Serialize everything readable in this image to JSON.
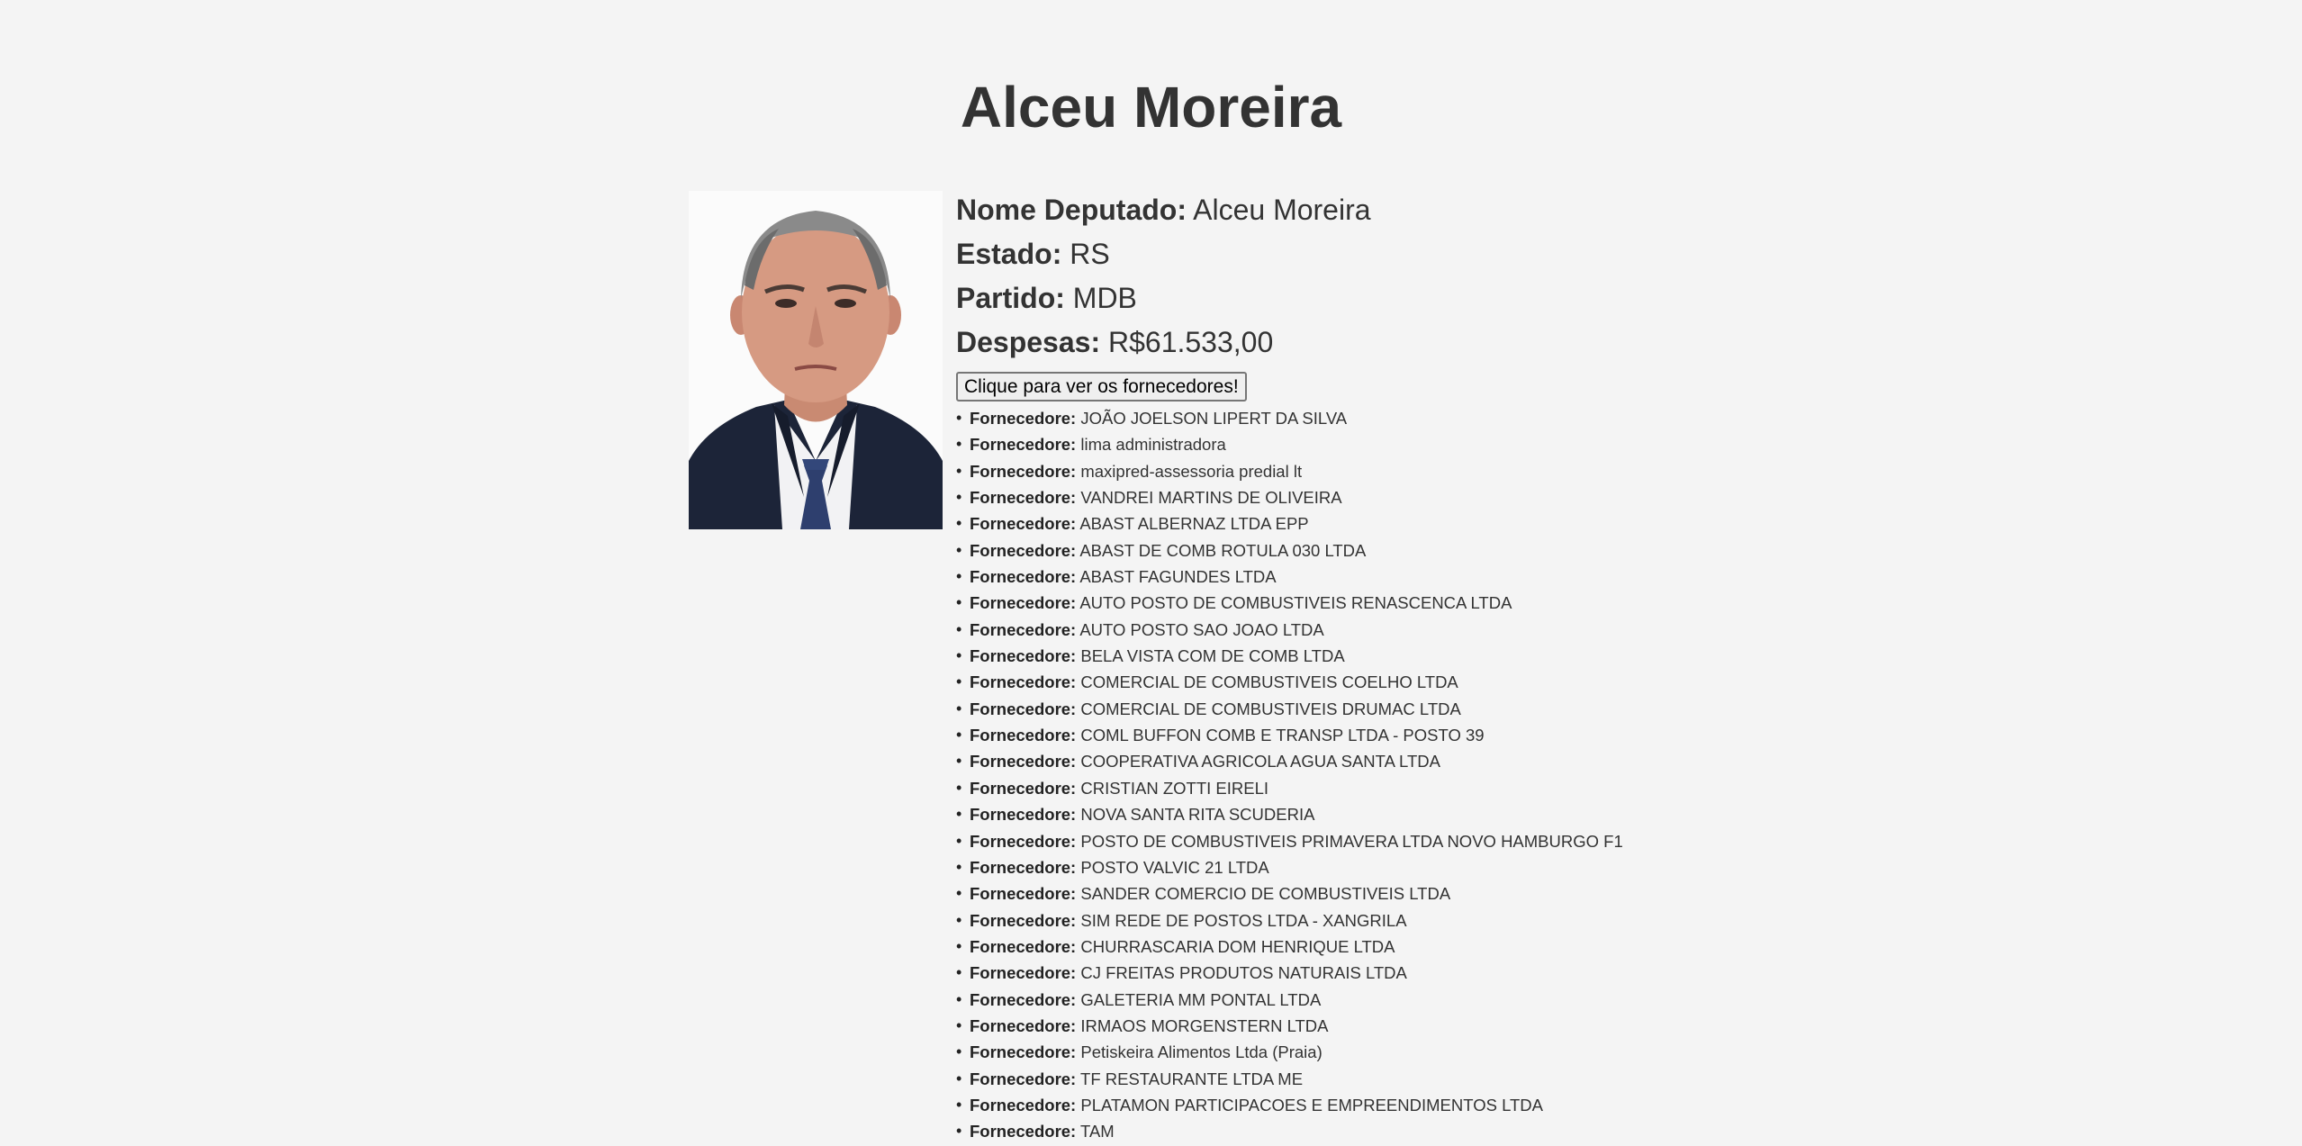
{
  "page": {
    "title": "Alceu Moreira"
  },
  "details": {
    "name_label": "Nome Deputado:",
    "name_value": "Alceu Moreira",
    "state_label": "Estado:",
    "state_value": "RS",
    "party_label": "Partido:",
    "party_value": "MDB",
    "expenses_label": "Despesas:",
    "expenses_value": "R$61.533,00"
  },
  "button": {
    "label": "Clique para ver os fornecedores!"
  },
  "suppliers": {
    "label": "Fornecedore:",
    "items": [
      "JOÃO JOELSON LIPERT DA SILVA",
      "lima administradora",
      "maxipred-assessoria predial lt",
      "VANDREI MARTINS DE OLIVEIRA",
      "ABAST ALBERNAZ LTDA EPP",
      "ABAST DE COMB ROTULA 030 LTDA",
      "ABAST FAGUNDES LTDA",
      "AUTO POSTO DE COMBUSTIVEIS RENASCENCA LTDA",
      "AUTO POSTO SAO JOAO LTDA",
      "BELA VISTA COM DE COMB LTDA",
      "COMERCIAL DE COMBUSTIVEIS COELHO LTDA",
      "COMERCIAL DE COMBUSTIVEIS DRUMAC LTDA",
      "COML BUFFON COMB E TRANSP LTDA - POSTO 39",
      "COOPERATIVA AGRICOLA AGUA SANTA LTDA",
      "CRISTIAN ZOTTI EIRELI",
      "NOVA SANTA RITA SCUDERIA",
      "POSTO DE COMBUSTIVEIS PRIMAVERA LTDA NOVO HAMBURGO F1",
      "POSTO VALVIC 21 LTDA",
      "SANDER COMERCIO DE COMBUSTIVEIS LTDA",
      "SIM REDE DE POSTOS LTDA - XANGRILA",
      "CHURRASCARIA DOM HENRIQUE LTDA",
      "CJ FREITAS PRODUTOS NATURAIS LTDA",
      "GALETERIA MM PONTAL LTDA",
      "IRMAOS MORGENSTERN LTDA",
      "Petiskeira Alimentos Ltda (Praia)",
      "TF RESTAURANTE LTDA ME",
      "PLATAMON PARTICIPACOES E EMPREENDIMENTOS LTDA",
      "TAM"
    ]
  },
  "icons": {
    "portrait": "deputy-photo"
  }
}
